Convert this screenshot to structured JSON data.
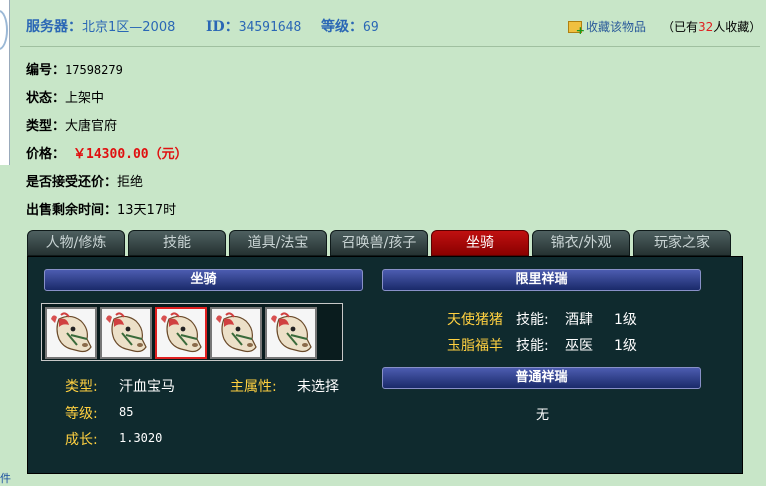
{
  "header": {
    "server_label": "服务器：",
    "server_value": "北京1区—2008",
    "id_label": "ID：",
    "id_value": "34591648",
    "level_label": "等级：",
    "level_value": "69",
    "favorite_label": "收藏该物品",
    "fav_prefix": "（已有",
    "fav_count": "32",
    "fav_suffix": "人收藏）"
  },
  "info": {
    "number_label": "编号：",
    "number_value": "17598279",
    "status_label": "状态：",
    "status_value": "上架中",
    "type_label": "类型：",
    "type_value": "大唐官府",
    "price_label": "价格：",
    "price_value": "￥14300.00（元）",
    "bargain_label": "是否接受还价：",
    "bargain_value": "拒绝",
    "remaining_label": "出售剩余时间：",
    "remaining_value": "13天17时"
  },
  "tabs": [
    "人物/修炼",
    "技能",
    "道具/法宝",
    "召唤兽/孩子",
    "坐骑",
    "锦衣/外观",
    "玩家之家"
  ],
  "active_tab": 4,
  "mount": {
    "section_title": "坐骑",
    "type_label": "类型:",
    "type_value": "汗血宝马",
    "main_attr_label": "主属性:",
    "main_attr_value": "未选择",
    "level_label": "等级:",
    "level_value": "85",
    "growth_label": "成长:",
    "growth_value": "1.3020",
    "selected_index": 2
  },
  "limited": {
    "title": "限里祥瑞",
    "items": [
      {
        "name": "天使猪猪",
        "skill_label": "技能:",
        "skill": "酒肆",
        "level": "1级"
      },
      {
        "name": "玉脂福羊",
        "skill_label": "技能:",
        "skill": "巫医",
        "level": "1级"
      }
    ]
  },
  "normal": {
    "title": "普通祥瑞",
    "value": "无"
  },
  "left_edge_text": "件",
  "colors": {
    "background": "#c8e6c8",
    "header_blue": "#2a67b5",
    "price_red": "#e01010",
    "tab_active": "#c01010",
    "panel_bg": "#0f2a2e",
    "label_gold": "#ffd040"
  }
}
